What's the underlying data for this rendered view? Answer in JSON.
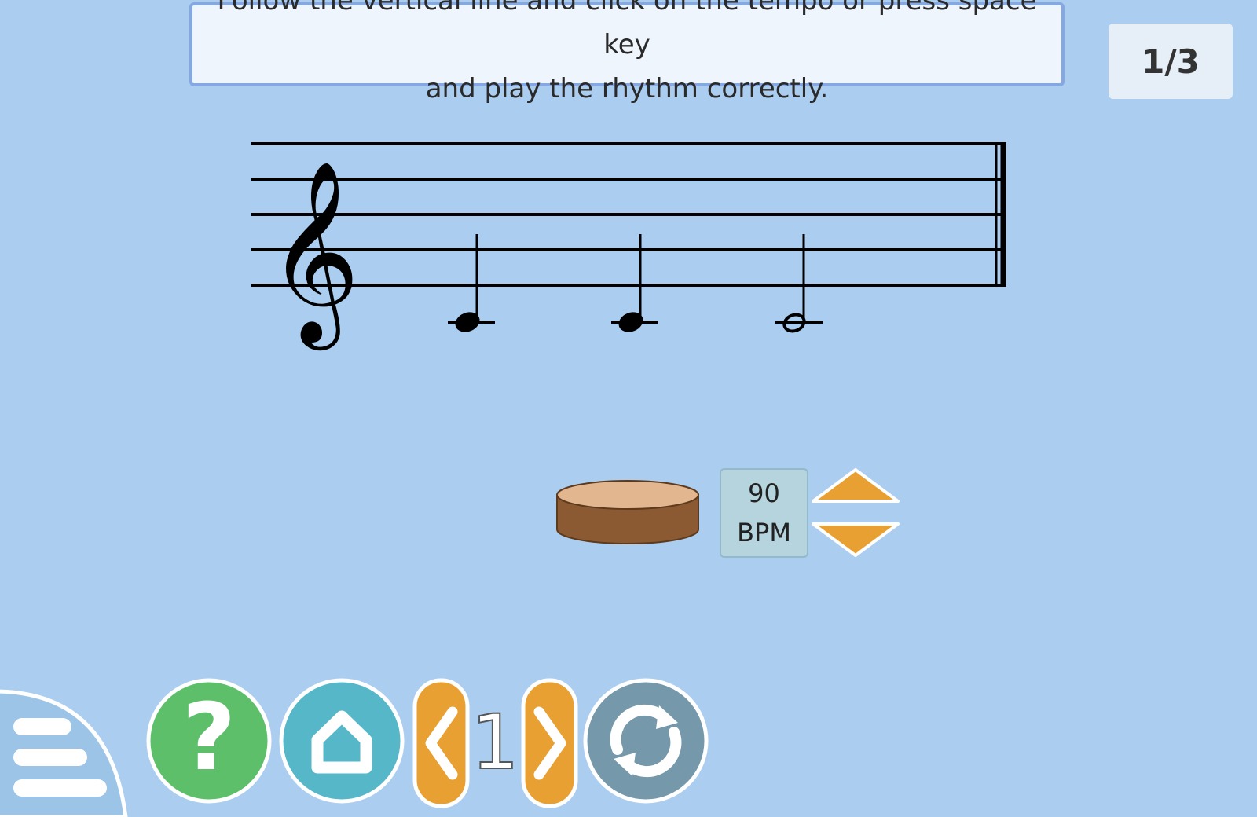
{
  "instructions": {
    "line1": "Follow the vertical line and click on the tempo or press space key",
    "line2": "and play the rhythm correctly."
  },
  "progress": {
    "label": "1/3"
  },
  "score": {
    "clef": "treble-clef",
    "notes": [
      "quarter",
      "quarter",
      "half"
    ]
  },
  "tempo": {
    "value": "90",
    "unit": "BPM"
  },
  "nav": {
    "page": "1"
  },
  "colors": {
    "background": "#abcdf0",
    "orange": "#e8a033",
    "help": "#5dbf6a",
    "home": "#56b7c9",
    "reload": "#7598aa",
    "drum_top": "#e2b68f",
    "drum_side": "#8b5a32"
  },
  "icons": [
    "drum-icon",
    "arrow-up-icon",
    "arrow-down-icon",
    "menu-icon",
    "question-icon",
    "home-icon",
    "chevron-left-icon",
    "chevron-right-icon",
    "reload-icon"
  ]
}
